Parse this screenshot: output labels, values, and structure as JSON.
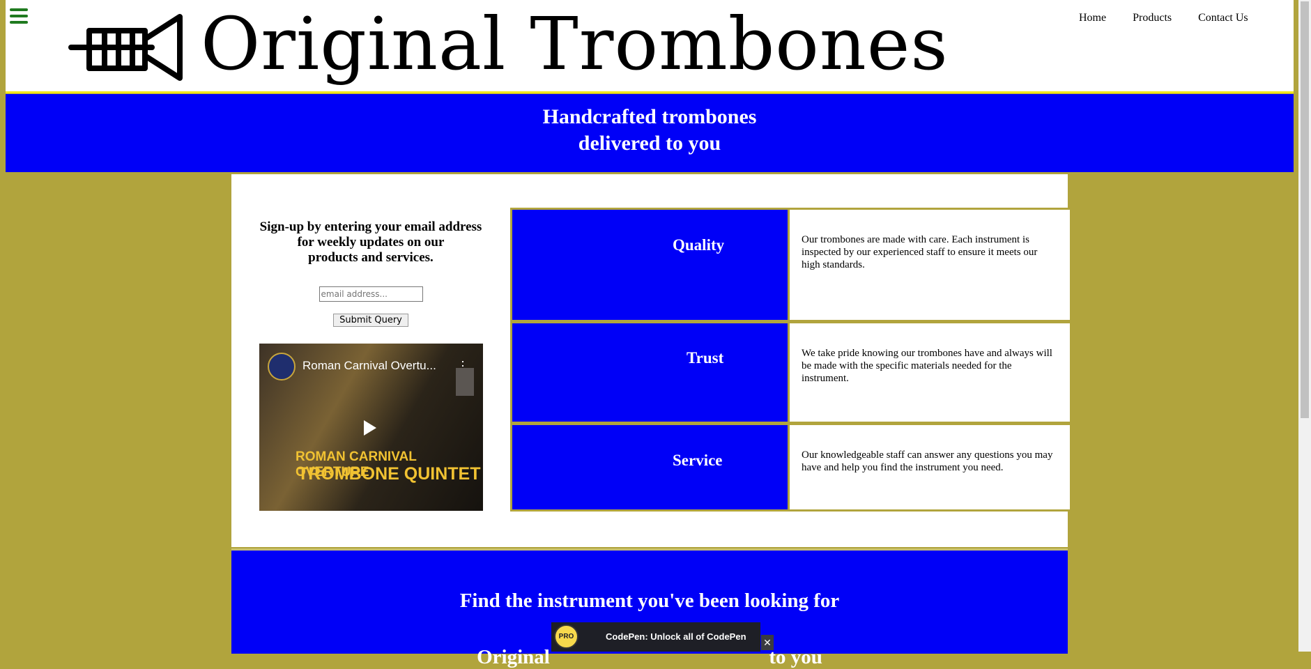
{
  "header": {
    "title": "Original Trombones",
    "nav": [
      "Home",
      "Products",
      "Contact Us"
    ]
  },
  "hero": {
    "line1": "Handcrafted trombones",
    "line2": "delivered to you"
  },
  "signup": {
    "text_line1": "Sign-up by entering your email address",
    "text_line2": "for weekly updates on our",
    "text_line3": "products and services.",
    "email_placeholder": "email address...",
    "submit_label": "Submit Query"
  },
  "video": {
    "title": "Roman Carnival Overtu...",
    "caption_line1": "ROMAN CARNIVAL OVERTURE",
    "caption_line2": "TROMBONE QUINTET"
  },
  "features": [
    {
      "title": "Quality",
      "desc": "Our trombones are made with care. Each instrument is inspected by our experienced staff to ensure it meets our high standards."
    },
    {
      "title": "Trust",
      "desc": "We take pride knowing our trombones have and always will be made with the specific materials needed for the instrument."
    },
    {
      "title": "Service",
      "desc": "Our knowledgeable staff can answer any questions you may have and help you find the instrument you need."
    }
  ],
  "banner": {
    "heading": "Find the instrument you've been looking for",
    "sub_left": "Original",
    "sub_right": "to you"
  },
  "promo": {
    "badge": "PRO",
    "text": "CodePen: Unlock all of CodePen",
    "close": "✕"
  },
  "colors": {
    "background": "#b1a43d",
    "accent_blue": "#0000f7",
    "header_border": "#f3e81c",
    "menu_icon": "#1f7a1f"
  }
}
